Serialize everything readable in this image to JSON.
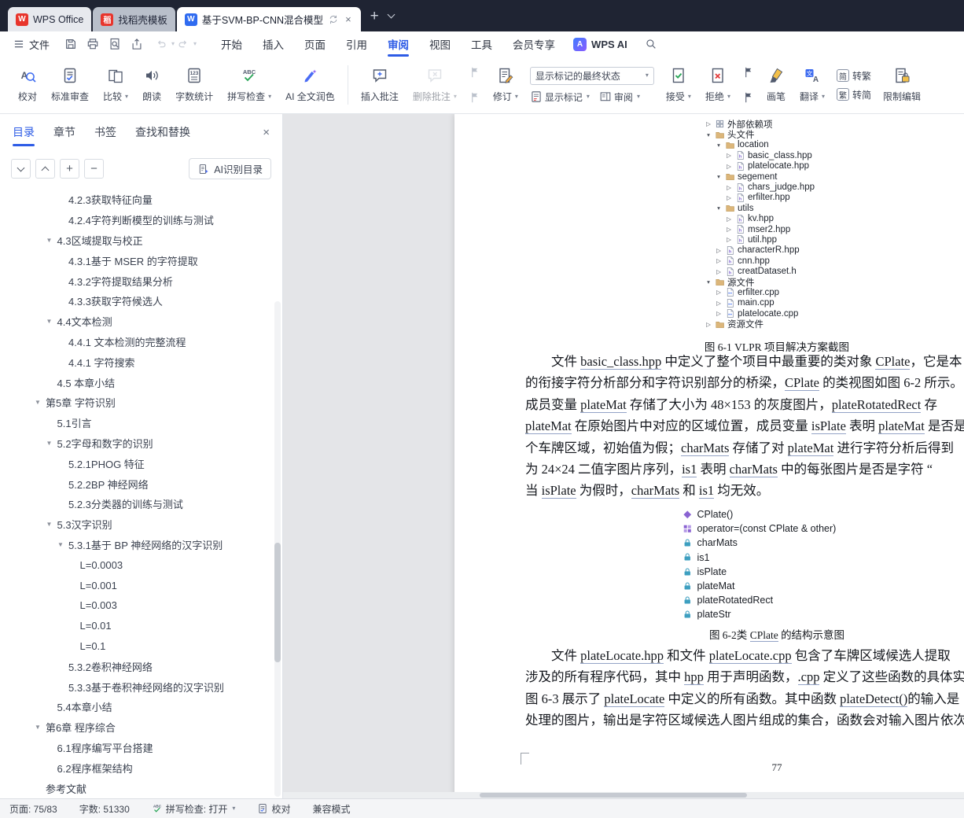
{
  "tabbar": {
    "tabs": [
      {
        "label": "WPS Office",
        "logo": "wps"
      },
      {
        "label": "找稻壳模板",
        "logo": "docer"
      },
      {
        "label": "基于SVM-BP-CNN混合模型",
        "logo": "writer",
        "active": true,
        "sync_icon": "sync",
        "close_icon": "×"
      }
    ],
    "new_tab_label": "+"
  },
  "menubar": {
    "file_label": "文件",
    "quick_actions": [
      {
        "icon": "save"
      },
      {
        "icon": "print"
      },
      {
        "icon": "print-preview"
      },
      {
        "icon": "export"
      }
    ],
    "tabs": [
      {
        "label": "开始"
      },
      {
        "label": "插入"
      },
      {
        "label": "页面"
      },
      {
        "label": "引用"
      },
      {
        "label": "审阅",
        "active": true
      },
      {
        "label": "视图"
      },
      {
        "label": "工具"
      },
      {
        "label": "会员专享"
      }
    ],
    "wps_ai_label": "WPS AI"
  },
  "ribbon": {
    "cells": [
      {
        "type": "big",
        "label": "校对",
        "icon": "proofread"
      },
      {
        "type": "big",
        "label": "标准审查",
        "icon": "audit"
      },
      {
        "type": "big",
        "label": "比较",
        "icon": "compare",
        "dd": true
      },
      {
        "type": "big",
        "label": "朗读",
        "icon": "speak"
      },
      {
        "type": "big",
        "label": "字数统计",
        "icon": "wordcount"
      },
      {
        "type": "big",
        "label": "拼写检查",
        "icon": "spell",
        "dd": true
      },
      {
        "type": "big",
        "label": "AI 全文润色",
        "icon": "aipolish"
      },
      {
        "type": "divider"
      },
      {
        "type": "big",
        "label": "插入批注",
        "icon": "comment-add"
      },
      {
        "type": "big",
        "label": "删除批注",
        "icon": "comment-del",
        "dd": true,
        "disabled": true
      },
      {
        "type": "stack-icons",
        "icons": [
          "prev-comment",
          "next-comment"
        ],
        "disabled": true
      },
      {
        "type": "big",
        "label": "修订",
        "icon": "revise",
        "dd": true
      },
      {
        "type": "combo-col",
        "combo": "显示标记的最终状态",
        "buttons": [
          {
            "label": "显示标记",
            "icon": "showmark",
            "dd": true
          },
          {
            "label": "审阅",
            "icon": "reviewpane",
            "dd": true
          }
        ]
      },
      {
        "type": "big",
        "label": "接受",
        "icon": "accept",
        "dd": true
      },
      {
        "type": "big",
        "label": "拒绝",
        "icon": "reject",
        "dd": true
      },
      {
        "type": "stack-icons",
        "icons": [
          "prev-revision",
          "next-revision"
        ]
      },
      {
        "type": "big",
        "label": "画笔",
        "icon": "brush"
      },
      {
        "type": "big",
        "label": "翻译",
        "icon": "translate",
        "dd": true
      },
      {
        "type": "stack-buttons",
        "buttons": [
          {
            "icon_char": "简",
            "label": "转繁"
          },
          {
            "icon_char": "繁",
            "label": "转简"
          }
        ]
      },
      {
        "type": "big",
        "label": "限制编辑",
        "icon": "restrict"
      }
    ]
  },
  "sidebar": {
    "t abs_note": "",
    "tabs": [
      {
        "label": "目录",
        "active": true
      },
      {
        "label": "章节"
      },
      {
        "label": "书签"
      },
      {
        "label": "查找和替换"
      }
    ],
    "close_label": "×",
    "tools": [
      {
        "name": "collapse-all",
        "glyph": "down"
      },
      {
        "name": "expand-all",
        "glyph": "up"
      },
      {
        "name": "zoom-in",
        "glyph": "plus"
      },
      {
        "name": "zoom-out",
        "glyph": "minus"
      }
    ],
    "ai_button_label": "AI识别目录",
    "toc": [
      {
        "label": "4.2.3获取特征向量",
        "level": 2
      },
      {
        "label": "4.2.4字符判断模型的训练与测试",
        "level": 2
      },
      {
        "label": "4.3区域提取与校正",
        "level": 1,
        "expanded": true
      },
      {
        "label": "4.3.1基于 MSER 的字符提取",
        "level": 2
      },
      {
        "label": "4.3.2字符提取结果分析",
        "level": 2
      },
      {
        "label": "4.3.3获取字符候选人",
        "level": 2
      },
      {
        "label": "4.4文本检测",
        "level": 1,
        "expanded": true
      },
      {
        "label": "4.4.1 文本检测的完整流程",
        "level": 2
      },
      {
        "label": "4.4.1 字符搜索",
        "level": 2
      },
      {
        "label": "4.5 本章小结",
        "level": 1
      },
      {
        "label": "第5章 字符识别",
        "level": 0,
        "expanded": true
      },
      {
        "label": "5.1引言",
        "level": 1
      },
      {
        "label": "5.2字母和数字的识别",
        "level": 1,
        "expanded": true
      },
      {
        "label": "5.2.1PHOG 特征",
        "level": 2
      },
      {
        "label": "5.2.2BP 神经网络",
        "level": 2
      },
      {
        "label": "5.2.3分类器的训练与测试",
        "level": 2
      },
      {
        "label": "5.3汉字识别",
        "level": 1,
        "expanded": true
      },
      {
        "label": "5.3.1基于 BP 神经网络的汉字识别",
        "level": 2,
        "expanded": true
      },
      {
        "label": "L=0.0003",
        "level": 3
      },
      {
        "label": "L=0.001",
        "level": 3
      },
      {
        "label": "L=0.003",
        "level": 3
      },
      {
        "label": "L=0.01",
        "level": 3
      },
      {
        "label": "L=0.1",
        "level": 3
      },
      {
        "label": "5.3.2卷积神经网络",
        "level": 2
      },
      {
        "label": "5.3.3基于卷积神经网络的汉字识别",
        "level": 2
      },
      {
        "label": "5.4本章小结",
        "level": 1
      },
      {
        "label": "第6章 程序综合",
        "level": 0,
        "expanded": true
      },
      {
        "label": "6.1程序编写平台搭建",
        "level": 1
      },
      {
        "label": "6.2程序框架结构",
        "level": 1
      },
      {
        "label": "参考文献",
        "level": 0
      }
    ]
  },
  "document": {
    "solution_tree": [
      {
        "label": "外部依赖项",
        "level": 0,
        "arrow": "right",
        "icon": "ext"
      },
      {
        "label": "头文件",
        "level": 0,
        "arrow": "down",
        "icon": "folder"
      },
      {
        "label": "location",
        "level": 1,
        "arrow": "down",
        "icon": "folder"
      },
      {
        "label": "basic_class.hpp",
        "level": 2,
        "arrow": "right",
        "icon": "hpp"
      },
      {
        "label": "platelocate.hpp",
        "level": 2,
        "arrow": "right",
        "icon": "hpp"
      },
      {
        "label": "segement",
        "level": 1,
        "arrow": "down",
        "icon": "folder"
      },
      {
        "label": "chars_judge.hpp",
        "level": 2,
        "arrow": "right",
        "icon": "hpp"
      },
      {
        "label": "erfilter.hpp",
        "level": 2,
        "arrow": "right",
        "icon": "hpp"
      },
      {
        "label": "utils",
        "level": 1,
        "arrow": "down",
        "icon": "folder"
      },
      {
        "label": "kv.hpp",
        "level": 2,
        "arrow": "right",
        "icon": "hpp"
      },
      {
        "label": "mser2.hpp",
        "level": 2,
        "arrow": "right",
        "icon": "hpp"
      },
      {
        "label": "util.hpp",
        "level": 2,
        "arrow": "right",
        "icon": "hpp"
      },
      {
        "label": "characterR.hpp",
        "level": 1,
        "arrow": "right",
        "icon": "hpp"
      },
      {
        "label": "cnn.hpp",
        "level": 1,
        "arrow": "right",
        "icon": "hpp"
      },
      {
        "label": "creatDataset.h",
        "level": 1,
        "arrow": "right",
        "icon": "hpp"
      },
      {
        "label": "源文件",
        "level": 0,
        "arrow": "down",
        "icon": "folder"
      },
      {
        "label": "erfilter.cpp",
        "level": 1,
        "arrow": "right",
        "icon": "cpp"
      },
      {
        "label": "main.cpp",
        "level": 1,
        "arrow": "right",
        "icon": "cpp"
      },
      {
        "label": "platelocate.cpp",
        "level": 1,
        "arrow": "right",
        "icon": "cpp"
      },
      {
        "label": "资源文件",
        "level": 0,
        "arrow": "right",
        "icon": "folder"
      }
    ],
    "fig1_caption": "图 6-1 VLPR 项目解决方案截图",
    "para1_lines": [
      [
        {
          "t": "　　文件 "
        },
        {
          "t": "basic_class.hpp",
          "u": true
        },
        {
          "t": " 中定义了整个项目中最重要的类对象 "
        },
        {
          "t": "CPlate",
          "u": true
        },
        {
          "t": "，它是本"
        }
      ],
      [
        {
          "t": "的衔接字符分析部分和字符识别部分的桥梁，"
        },
        {
          "t": "CPlate",
          "u": true
        },
        {
          "t": " 的类视图如图 6-2 所示。"
        }
      ],
      [
        {
          "t": "成员变量 "
        },
        {
          "t": "plateMat",
          "u": true
        },
        {
          "t": " 存储了大小为 48×153 的灰度图片，"
        },
        {
          "t": "plateRotatedRect",
          "u": true
        },
        {
          "t": " 存"
        }
      ],
      [
        {
          "t": "plateMat",
          "u": true
        },
        {
          "t": " 在原始图片中对应的区域位置，成员变量 "
        },
        {
          "t": "isPlate",
          "u": true
        },
        {
          "t": " 表明 "
        },
        {
          "t": "plateMat",
          "u": true
        },
        {
          "t": " 是否是"
        }
      ],
      [
        {
          "t": "个车牌区域，初始值为假；"
        },
        {
          "t": "charMats",
          "u": true
        },
        {
          "t": " 存储了对 "
        },
        {
          "t": "plateMat",
          "u": true
        },
        {
          "t": " 进行字符分析后得到"
        }
      ],
      [
        {
          "t": "为 24×24 二值字图片序列，"
        },
        {
          "t": "is1",
          "u": true
        },
        {
          "t": " 表明 "
        },
        {
          "t": "charMats",
          "u": true
        },
        {
          "t": " 中的每张图片是否是字符 “"
        }
      ],
      [
        {
          "t": "当 "
        },
        {
          "t": "isPlate",
          "u": true
        },
        {
          "t": " 为假时，"
        },
        {
          "t": "charMats",
          "u": true
        },
        {
          "t": " 和 "
        },
        {
          "t": "is1",
          "u": true
        },
        {
          "t": " 均无效。"
        }
      ]
    ],
    "class_members": [
      {
        "icon": "method",
        "label": "CPlate()"
      },
      {
        "icon": "method-grid",
        "label": "operator=(const CPlate & other)"
      },
      {
        "icon": "field",
        "label": "charMats"
      },
      {
        "icon": "field",
        "label": "is1"
      },
      {
        "icon": "field",
        "label": "isPlate"
      },
      {
        "icon": "field",
        "label": "plateMat"
      },
      {
        "icon": "field",
        "label": "plateRotatedRect"
      },
      {
        "icon": "field",
        "label": "plateStr"
      }
    ],
    "fig2_caption": [
      {
        "t": "图 6-2类 "
      },
      {
        "t": "CPlate",
        "u": true
      },
      {
        "t": " 的结构示意图"
      }
    ],
    "para2_lines": [
      [
        {
          "t": "　　文件 "
        },
        {
          "t": "plateLocate.hpp",
          "u": true
        },
        {
          "t": " 和文件 "
        },
        {
          "t": "plateLocate.cpp",
          "u": true
        },
        {
          "t": " 包含了车牌区域候选人提取"
        }
      ],
      [
        {
          "t": "涉及的所有程序代码，其中 "
        },
        {
          "t": "hpp",
          "u": true
        },
        {
          "t": " 用于声明函数，"
        },
        {
          "t": ".cpp",
          "u": true
        },
        {
          "t": " 定义了这些函数的具体实"
        }
      ],
      [
        {
          "t": "图 6-3 展示了 "
        },
        {
          "t": "plateLocate",
          "u": true
        },
        {
          "t": " 中定义的所有函数。其中函数 "
        },
        {
          "t": "plateDetect()",
          "u": true
        },
        {
          "t": "的输入是"
        }
      ],
      [
        {
          "t": "处理的图片，输出是字符区域候选人图片组成的集合，函数会对输入图片依次执行"
        }
      ]
    ],
    "page_number": "77"
  },
  "statusbar": {
    "page_label": "页面: 75/83",
    "wordcount_label": "字数: 51330",
    "spell_label": "拼写检查: 打开",
    "proof_label": "校对",
    "mode_label": "兼容模式"
  }
}
